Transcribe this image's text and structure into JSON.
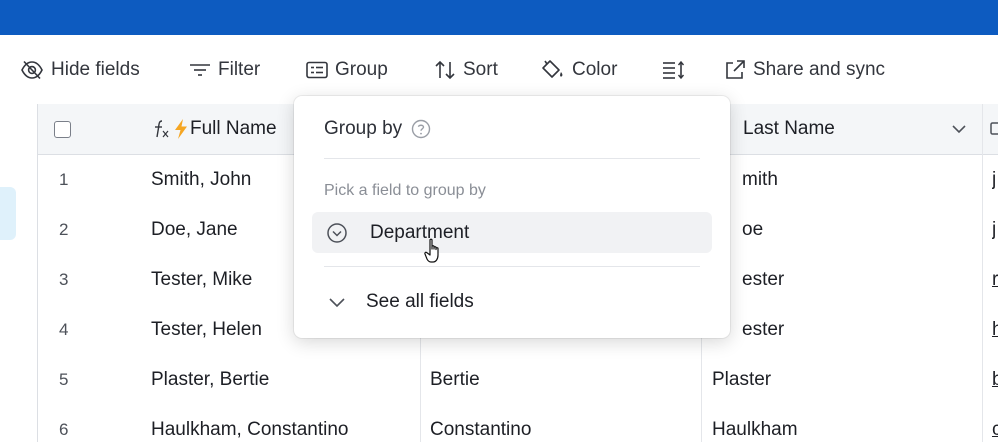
{
  "toolbar": {
    "hide_fields": "Hide fields",
    "filter": "Filter",
    "group": "Group",
    "sort": "Sort",
    "color": "Color",
    "share": "Share and sync"
  },
  "columns": {
    "full_name": "Full Name",
    "last_name": "Last Name"
  },
  "rows": [
    {
      "num": "1",
      "full": "Smith, John",
      "first": "",
      "last": "mith",
      "extra": "j"
    },
    {
      "num": "2",
      "full": "Doe, Jane",
      "first": "",
      "last": "oe",
      "extra": "j"
    },
    {
      "num": "3",
      "full": "Tester, Mike",
      "first": "",
      "last": "ester",
      "extra": "r"
    },
    {
      "num": "4",
      "full": "Tester, Helen",
      "first": "",
      "last": "ester",
      "extra": "h"
    },
    {
      "num": "5",
      "full": "Plaster, Bertie",
      "first": "Bertie",
      "last": "Plaster",
      "extra": "b"
    },
    {
      "num": "6",
      "full": "Haulkham, Constantino",
      "first": "Constantino",
      "last": "Haulkham",
      "extra": "c"
    }
  ],
  "group_popup": {
    "title": "Group by",
    "subtitle": "Pick a field to group by",
    "option": "Department",
    "see_all": "See all fields"
  },
  "colors": {
    "topbar": "#0d5bc0",
    "formula_bolt": "#f5a623"
  }
}
